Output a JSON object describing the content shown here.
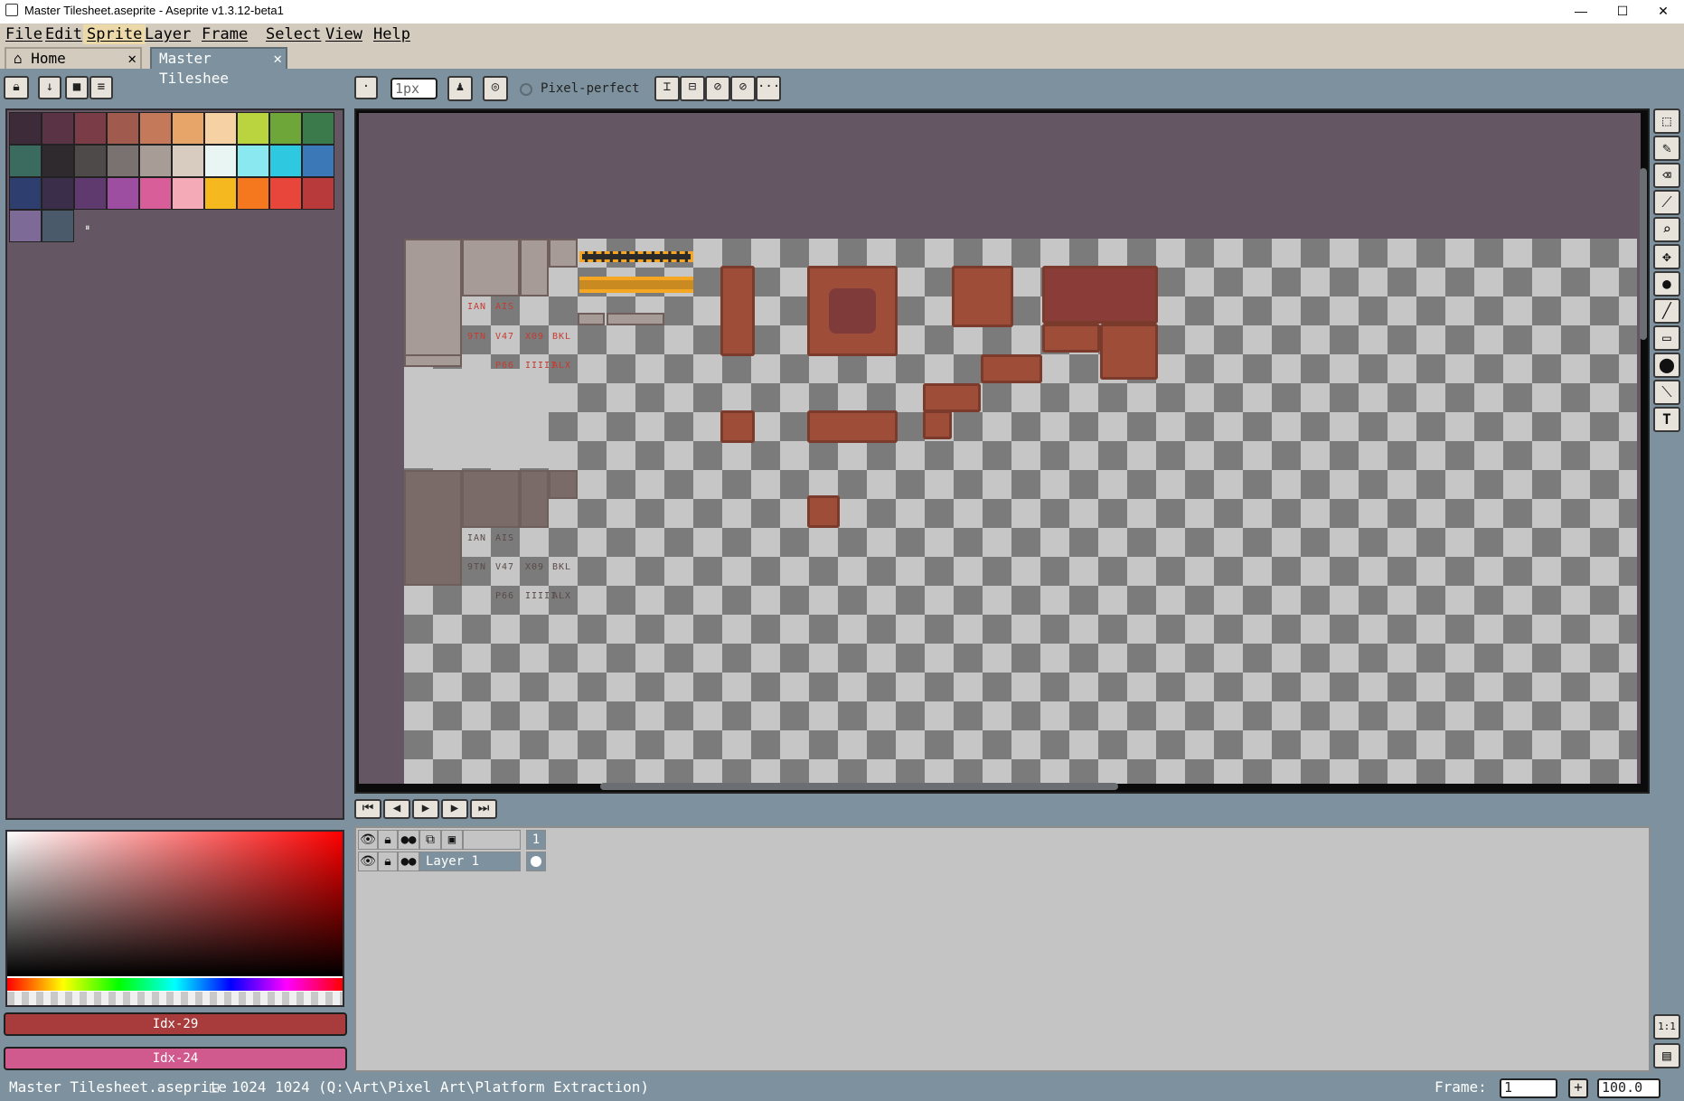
{
  "window": {
    "title": "Master Tilesheet.aseprite - Aseprite v1.3.12-beta1",
    "minimize": "—",
    "maximize": "☐",
    "close": "✕"
  },
  "menu": [
    "File",
    "Edit",
    "Sprite",
    "Layer",
    "Frame",
    "Select",
    "View",
    "Help"
  ],
  "tabs": {
    "home": "Home",
    "document": "Master Tileshee",
    "close": "✕"
  },
  "brush_bar": {
    "size": "1px",
    "pixel_perfect": "Pixel-perfect",
    "more": "···"
  },
  "palette": {
    "colors": [
      "#3e2b3a",
      "#5a3344",
      "#7a3c46",
      "#a05a4e",
      "#c47a5a",
      "#e8a56a",
      "#f5d1a3",
      "#b9d43e",
      "#6fa63a",
      "#3b7a4a",
      "#3b6a5e",
      "#2e2a2d",
      "#4e4a4a",
      "#7a7270",
      "#a89c96",
      "#d8ccc0",
      "#e8f5f2",
      "#8ae8f0",
      "#2ec8e0",
      "#3a78b8",
      "#2e3e6e",
      "#3a2e4a",
      "#5e3a6e",
      "#9e4ea0",
      "#d85e9a",
      "#f5aab8",
      "#f5b81e",
      "#f5781e",
      "#e8463a",
      "#b83a3a",
      "#7e6a96",
      "#4a5a6a"
    ],
    "extra": "⏸"
  },
  "indices": {
    "foreground": "Idx-29",
    "foreground_color": "#a83c3c",
    "background": "Idx-24",
    "background_color": "#d05a8e"
  },
  "tile_labels": {
    "row1": [
      "IAN",
      "AIS",
      "",
      ""
    ],
    "row2": [
      "9TN",
      "V47",
      "X09",
      "BKL"
    ],
    "row3": [
      "",
      "P66",
      "IIIII",
      "ALX"
    ],
    "row4": [
      "IAN",
      "AIS",
      "",
      ""
    ],
    "row5": [
      "9TN",
      "V47",
      "X09",
      "BKL"
    ],
    "row6": [
      "",
      "P66",
      "IIIII",
      "ALX"
    ]
  },
  "timeline": {
    "frame_number": "1",
    "layer_name": "Layer 1"
  },
  "status": {
    "filename": "Master Tilesheet.aseprite",
    "size": "1024 1024",
    "path": "(Q:\\Art\\Pixel Art\\Platform Extraction)",
    "frame_label": "Frame:",
    "frame_value": "1",
    "add": "+",
    "zoom": "100.0"
  },
  "side_buttons": {
    "ratio": "1:1"
  }
}
